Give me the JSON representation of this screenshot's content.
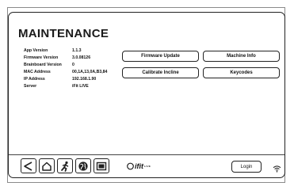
{
  "header": {
    "title": "MAINTENANCE"
  },
  "info": [
    {
      "label": "App Version",
      "value": "1.1.3"
    },
    {
      "label": "Firmware Version",
      "value": "3.0.08126"
    },
    {
      "label": "Brainboard Version",
      "value": "0"
    },
    {
      "label": "MAC Address",
      "value": "00,1A,13,0A,B3,84"
    },
    {
      "label": "IP Address",
      "value": "192.168.1.90"
    },
    {
      "label": "Server",
      "value": "iFit LIVE"
    }
  ],
  "buttons": {
    "firmware_update": "Firmware Update",
    "machine_info": "Machine Info",
    "calibrate_incline": "Calibrate Incline",
    "keycodes": "Keycodes"
  },
  "footer": {
    "nav_icons": [
      "back-icon",
      "home-icon",
      "runner-icon",
      "globe-icon",
      "screen-icon"
    ],
    "logo": {
      "mark": "ifit",
      "suffix": "LIVE"
    },
    "login_label": "Login",
    "wifi_icon": "wifi-icon"
  }
}
